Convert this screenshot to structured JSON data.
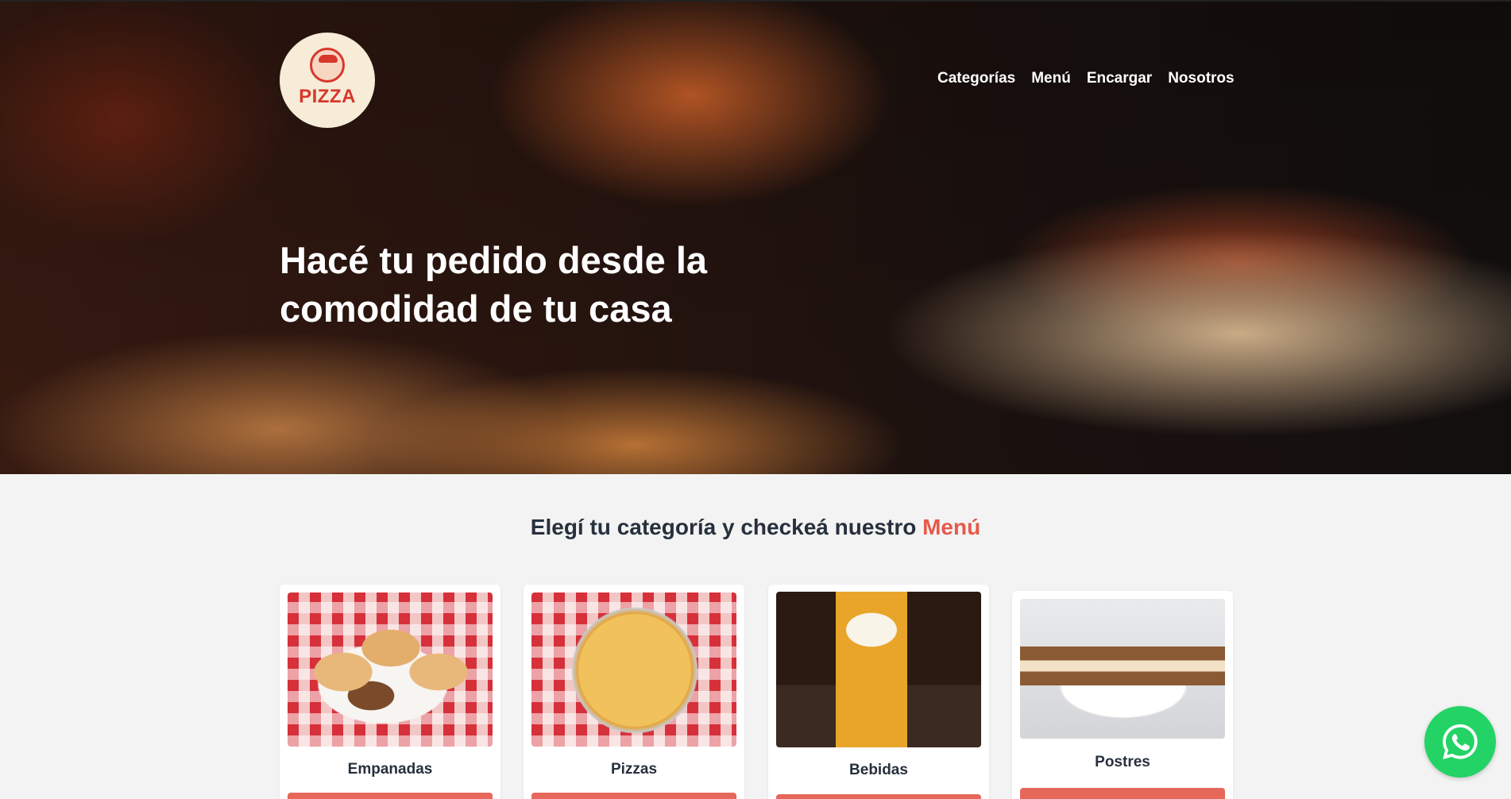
{
  "nav": {
    "items": [
      {
        "label": "Categorías"
      },
      {
        "label": "Menú"
      },
      {
        "label": "Encargar"
      },
      {
        "label": "Nosotros"
      }
    ]
  },
  "logo": {
    "text": "PIZZA"
  },
  "hero": {
    "title_line1": "Hacé tu pedido desde la",
    "title_line2": "comodidad de tu casa"
  },
  "section": {
    "heading_prefix": "Elegí tu categoría y checkeá nuestro ",
    "heading_accent": "Menú"
  },
  "categories": [
    {
      "label": "Empanadas"
    },
    {
      "label": "Pizzas"
    },
    {
      "label": "Bebidas"
    },
    {
      "label": "Postres"
    }
  ],
  "colors": {
    "accent": "#e5594b",
    "heading": "#27303d",
    "whatsapp": "#24d366",
    "page_bg": "#f3f3f3"
  },
  "icons": {
    "whatsapp": "whatsapp-icon"
  }
}
